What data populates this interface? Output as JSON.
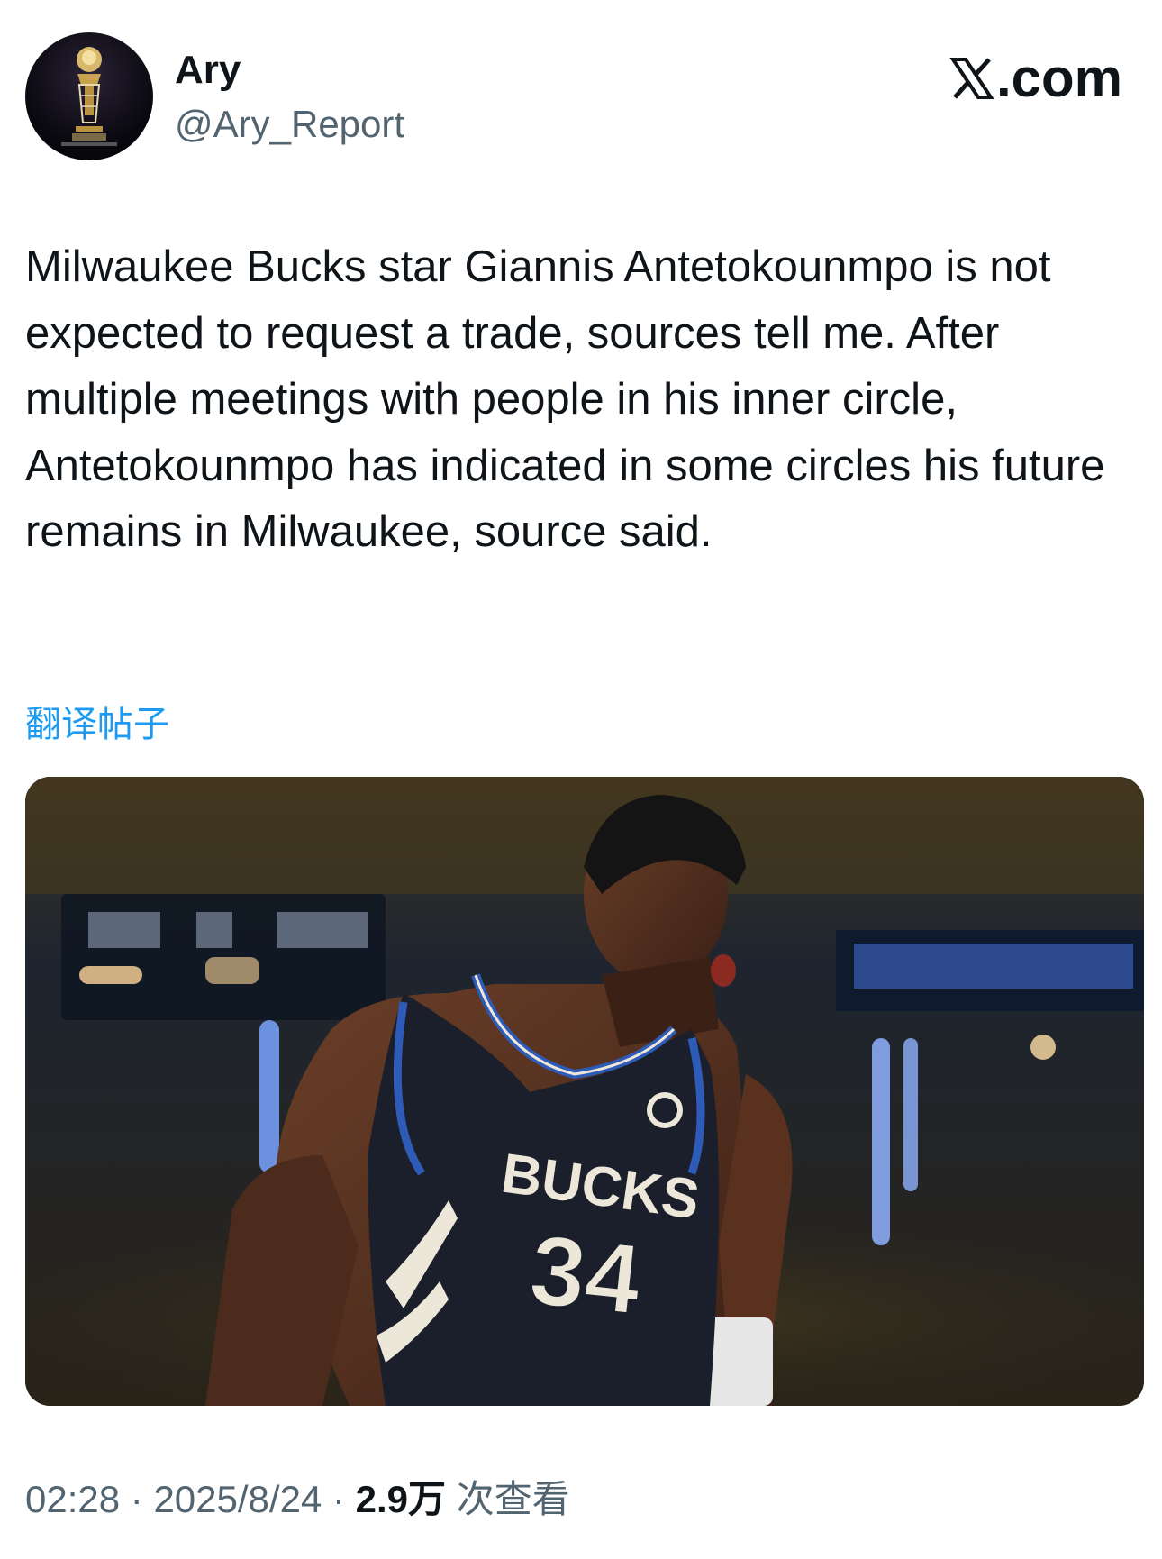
{
  "author": {
    "display_name": "Ary",
    "handle": "@Ary_Report",
    "avatar_icon": "trophy-avatar"
  },
  "brand": {
    "label": ".com",
    "icon": "x-logo-icon"
  },
  "tweet": {
    "text": "Milwaukee Bucks star Giannis Antetokounmpo is not expected to request a trade, sources tell me. After multiple meetings with people in his inner circle, Antetokounmpo has indicated in some circles his future remains in Milwaukee, source said.",
    "translate_label": "翻译帖子"
  },
  "media": {
    "jersey_team": "BUCKS",
    "jersey_number": "34",
    "colors": {
      "jersey": "#1a1f2b",
      "trim": "#2e5bb8",
      "lettering": "#ece7d9"
    }
  },
  "meta": {
    "time": "02:28",
    "separator": "·",
    "date": "2025/8/24",
    "views_count": "2.9万",
    "views_label": "次查看"
  },
  "colors": {
    "text_primary": "#0f1419",
    "text_secondary": "#536471",
    "link": "#1d9bf0"
  }
}
